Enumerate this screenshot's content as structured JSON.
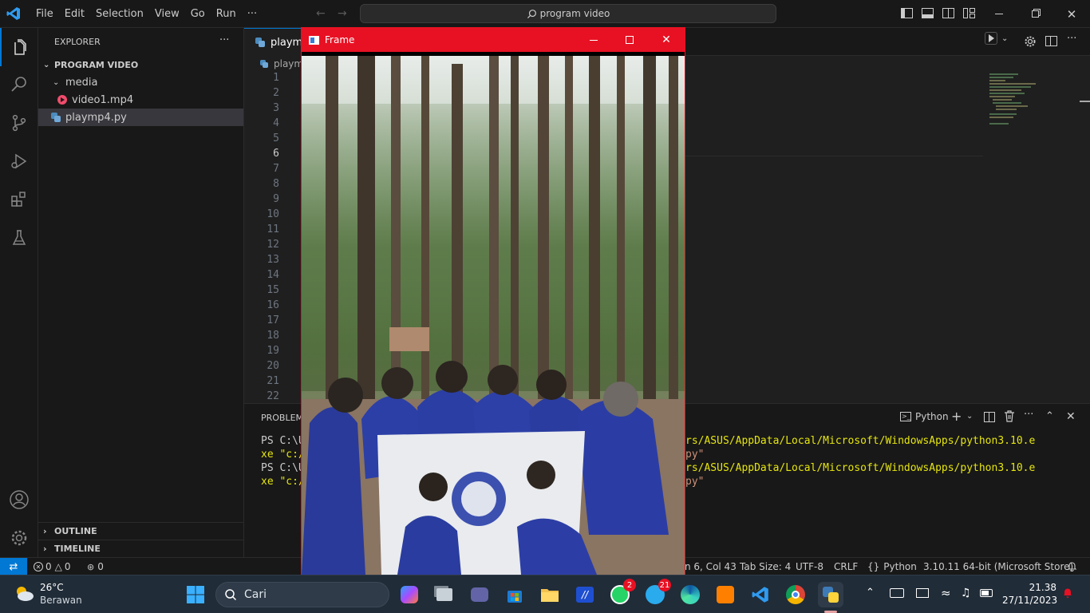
{
  "titlebar": {
    "menus": [
      "File",
      "Edit",
      "Selection",
      "View",
      "Go",
      "Run",
      "···"
    ],
    "search": "program video"
  },
  "sidebar": {
    "title": "EXPLORER",
    "more": "···",
    "folder": "PROGRAM VIDEO",
    "items": [
      {
        "label": "media"
      },
      {
        "label": "video1.mp4"
      },
      {
        "label": "playmp4.py"
      }
    ],
    "outline": "OUTLINE",
    "timeline": "TIMELINE"
  },
  "editor": {
    "tab_label": "playmp4.py",
    "breadcrumb": "playm",
    "line_numbers": [
      "1",
      "2",
      "3",
      "4",
      "5",
      "6",
      "7",
      "8",
      "9",
      "10",
      "11",
      "12",
      "13",
      "14",
      "15",
      "16",
      "17",
      "18",
      "19",
      "20",
      "21",
      "22"
    ],
    "active_line": "6"
  },
  "panel": {
    "tab": "PROBLEMS",
    "shell_label": "Python",
    "terminal_left": [
      "PS C:\\U",
      "xe \"c:/",
      "PS C:\\U",
      "xe \"c:/"
    ],
    "terminal_right": [
      "rs/ASUS/AppData/Local/Microsoft/WindowsApps/python3.10.e",
      "py\"",
      "rs/ASUS/AppData/Local/Microsoft/WindowsApps/python3.10.e",
      "py\""
    ]
  },
  "statusbar": {
    "errors": "0",
    "warnings": "0",
    "ports": "0",
    "position": "n 6, Col 43",
    "tab_size": "Tab Size: 4",
    "encoding": "UTF-8",
    "eol": "CRLF",
    "language": "Python",
    "interpreter": "3.10.11 64-bit (Microsoft Store)"
  },
  "frame_window": {
    "title": "Frame"
  },
  "taskbar": {
    "temperature": "26°C",
    "weather": "Berawan",
    "search_placeholder": "Cari",
    "whatsapp_badge": "2",
    "telegram_badge": "21",
    "time": "21.38",
    "date": "27/11/2023"
  },
  "colors": {
    "accent": "#0078d4",
    "frame_red": "#e81123",
    "terminal_yellow": "#e5e510"
  }
}
